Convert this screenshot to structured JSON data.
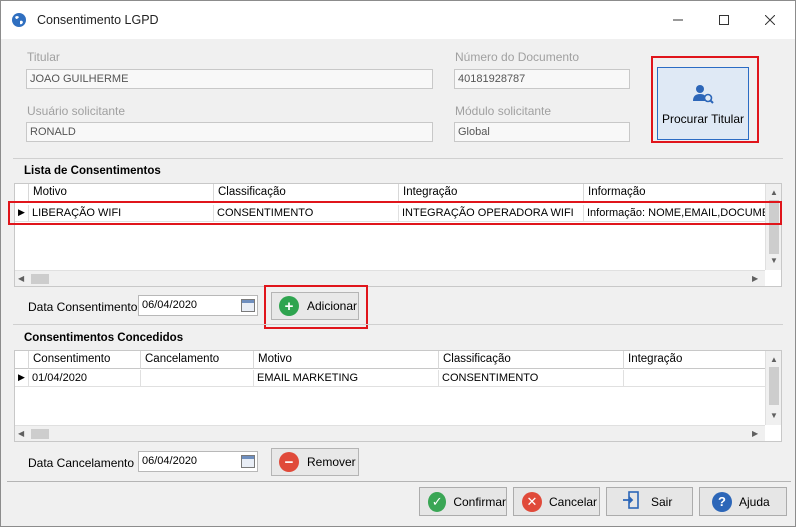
{
  "window": {
    "title": "Consentimento LGPD"
  },
  "titular": {
    "label": "Titular",
    "value": "JOAO GUILHERME",
    "doc_label": "Número do Documento",
    "doc_value": "40181928787",
    "user_label": "Usuário solicitante",
    "user_value": "RONALD",
    "module_label": "Módulo solicitante",
    "module_value": "Global",
    "search_button": "Procurar Titular"
  },
  "consents_list": {
    "title": "Lista de Consentimentos",
    "columns": [
      "Motivo",
      "Classificação",
      "Integração",
      "Informação"
    ],
    "rows": [
      [
        "LIBERAÇÃO WIFI",
        "CONSENTIMENTO",
        "INTEGRAÇÃO OPERADORA WIFI",
        "Informação: NOME,EMAIL,DOCUMENTO"
      ]
    ],
    "date_label": "Data Consentimento",
    "date_value": "06/04/2020",
    "add_button": "Adicionar"
  },
  "granted": {
    "title": "Consentimentos Concedidos",
    "columns": [
      "Consentimento",
      "Cancelamento",
      "Motivo",
      "Classificação",
      "Integração"
    ],
    "rows": [
      [
        "01/04/2020",
        "",
        "EMAIL MARKETING",
        "CONSENTIMENTO",
        ""
      ]
    ],
    "date_label": "Data Cancelamento",
    "date_value": "06/04/2020",
    "remove_button": "Remover"
  },
  "footer": {
    "confirm": "Confirmar",
    "cancel": "Cancelar",
    "exit": "Sair",
    "help": "Ajuda"
  },
  "colors": {
    "highlight": "#e0151b",
    "accent": "#2b6cc4"
  }
}
